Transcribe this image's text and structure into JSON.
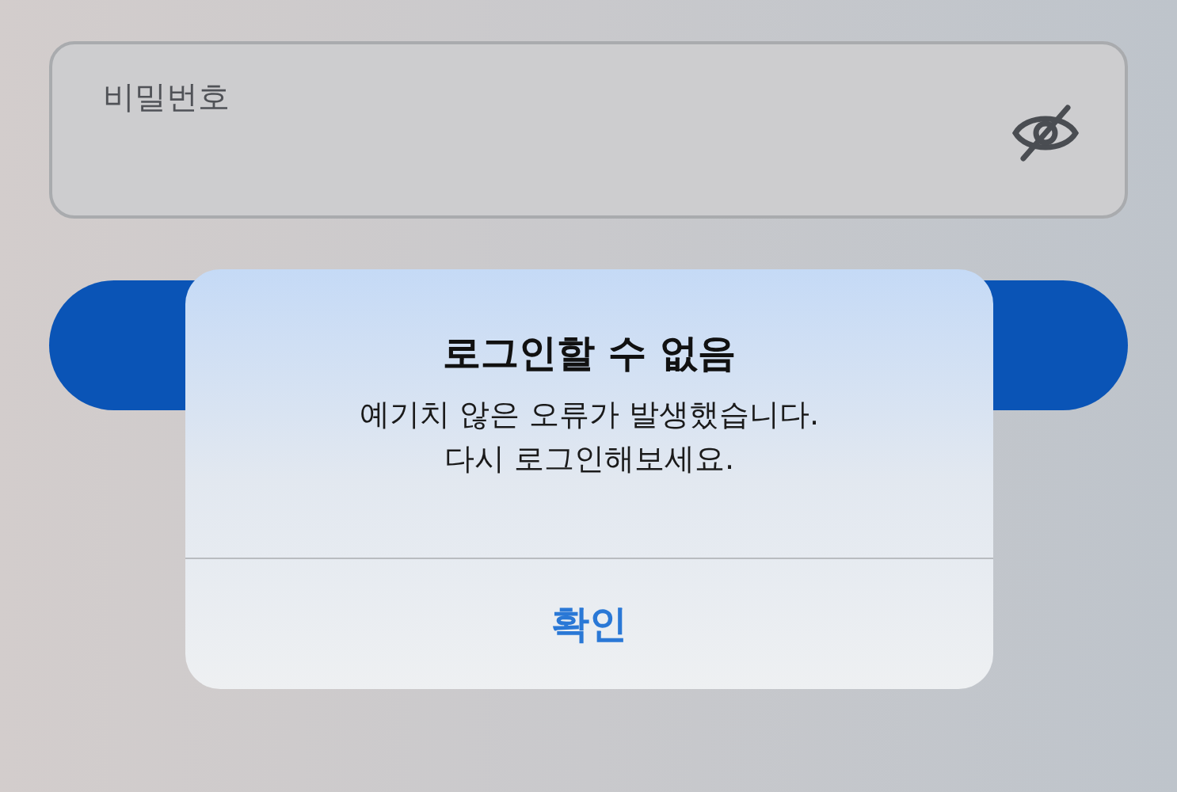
{
  "password_field": {
    "label": "비밀번호",
    "password_visible": false
  },
  "alert": {
    "title": "로그인할 수 없음",
    "message": [
      "예기치 않은 오류가 발생했습니다.",
      "다시 로그인해보세요."
    ],
    "button": "확인"
  }
}
